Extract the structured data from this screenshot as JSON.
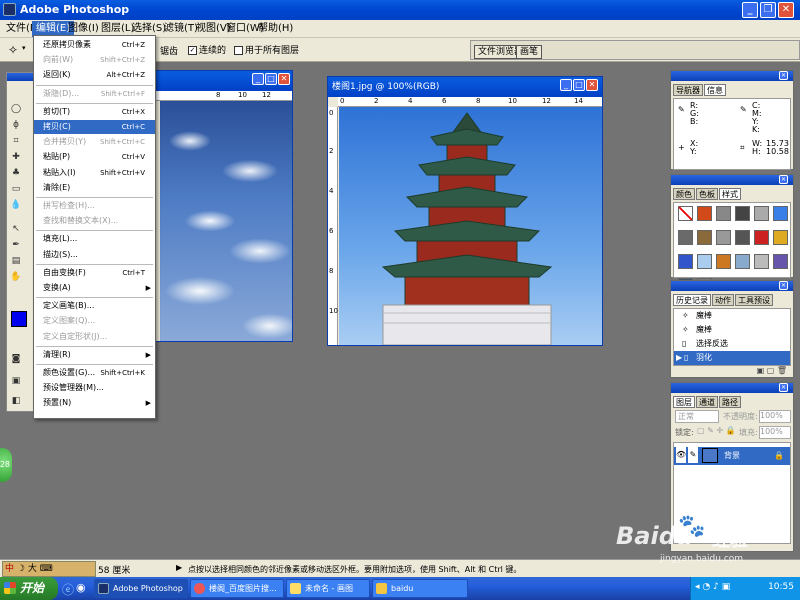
{
  "app": {
    "title": "Adobe Photoshop"
  },
  "menubar": [
    {
      "label": "文件(F)"
    },
    {
      "label": "编辑(E)"
    },
    {
      "label": "图像(I)"
    },
    {
      "label": "图层(L)"
    },
    {
      "label": "选择(S)"
    },
    {
      "label": "滤镜(T)"
    },
    {
      "label": "视图(V)"
    },
    {
      "label": "窗口(W)"
    },
    {
      "label": "帮助(H)"
    }
  ],
  "options": {
    "antialias_partial": "锯齿",
    "contiguous": "连续的",
    "all_layers": "用于所有图层"
  },
  "dock_tabs": [
    "文件浏览器",
    "画笔"
  ],
  "edit_menu": [
    {
      "label": "还原拷贝像素",
      "shortcut": "Ctrl+Z",
      "disabled": false
    },
    {
      "label": "向前(W)",
      "shortcut": "Shift+Ctrl+Z",
      "disabled": true
    },
    {
      "label": "返回(K)",
      "shortcut": "Alt+Ctrl+Z",
      "disabled": false
    },
    {
      "label": "渐隐(D)...",
      "shortcut": "Shift+Ctrl+F",
      "disabled": true
    },
    {
      "label": "剪切(T)",
      "shortcut": "Ctrl+X",
      "disabled": false
    },
    {
      "label": "拷贝(C)",
      "shortcut": "Ctrl+C",
      "disabled": false
    },
    {
      "label": "合并拷贝(Y)",
      "shortcut": "Shift+Ctrl+C",
      "disabled": true
    },
    {
      "label": "粘贴(P)",
      "shortcut": "Ctrl+V",
      "disabled": false
    },
    {
      "label": "粘贴入(I)",
      "shortcut": "Shift+Ctrl+V",
      "disabled": false
    },
    {
      "label": "清除(E)",
      "shortcut": "",
      "disabled": false
    },
    {
      "label": "拼写检查(H)...",
      "shortcut": "",
      "disabled": true
    },
    {
      "label": "查找和替换文本(X)...",
      "shortcut": "",
      "disabled": true
    },
    {
      "label": "填充(L)...",
      "shortcut": "",
      "disabled": false
    },
    {
      "label": "描边(S)...",
      "shortcut": "",
      "disabled": false
    },
    {
      "label": "自由变换(F)",
      "shortcut": "Ctrl+T",
      "disabled": false
    },
    {
      "label": "变换(A)",
      "shortcut": "",
      "disabled": false,
      "submenu": true
    },
    {
      "label": "定义画笔(B)...",
      "shortcut": "",
      "disabled": false
    },
    {
      "label": "定义图案(Q)...",
      "shortcut": "",
      "disabled": true
    },
    {
      "label": "定义自定形状(J)...",
      "shortcut": "",
      "disabled": true
    },
    {
      "label": "清理(R)",
      "shortcut": "",
      "disabled": false,
      "submenu": true
    },
    {
      "label": "颜色设置(G)...",
      "shortcut": "Shift+Ctrl+K",
      "disabled": false
    },
    {
      "label": "预设管理器(M)...",
      "shortcut": "",
      "disabled": false
    },
    {
      "label": "预置(N)",
      "shortcut": "",
      "disabled": false,
      "submenu": true
    }
  ],
  "edit_menu_highlighted": "拷贝(C)",
  "doc1": {
    "ruler": [
      "8",
      "10",
      "12"
    ]
  },
  "doc2": {
    "title": "楼阁1.jpg @ 100%(RGB)",
    "ruler": [
      "0",
      "2",
      "4",
      "6",
      "8",
      "10",
      "12",
      "14"
    ],
    "vruler": [
      "0",
      "2",
      "4",
      "6",
      "8",
      "10"
    ]
  },
  "navigator": {
    "tabs": [
      "导航器",
      "信息"
    ],
    "labels_left": [
      "R:",
      "G:",
      "B:"
    ],
    "labels_right": [
      "C:",
      "M:",
      "Y:",
      "K:"
    ],
    "x": "X:",
    "y": "Y:",
    "w": "W:",
    "h": "H:",
    "w_val": "15.73",
    "h_val": "10.58"
  },
  "swatches": {
    "tabs": [
      "颜色",
      "色板",
      "样式"
    ]
  },
  "history": {
    "tabs": [
      "历史记录",
      "动作",
      "工具预设"
    ],
    "items": [
      "魔棒",
      "魔棒",
      "选择反选",
      "羽化"
    ]
  },
  "layers": {
    "tabs": [
      "图层",
      "通道",
      "路径"
    ],
    "mode": "正常",
    "opacity_label": "不透明度:",
    "opacity": "100%",
    "lock_label": "锁定:",
    "fill_label": "填充:",
    "fill": "100%",
    "layer_name": "背景"
  },
  "status": {
    "ime": "中",
    "ime_extra": "大",
    "zoom": "58 厘米",
    "hint": "点按以选择相同颜色的邻近像素或移动选区外框。要用附加选项，使用 Shift、Alt 和 Ctrl 键。"
  },
  "taskbar": {
    "start": "开始",
    "tasks": [
      "Adobe Photoshop",
      "楼阁_百度图片搜...",
      "未命名 - 画图",
      "baidu"
    ],
    "clock": "10:55"
  },
  "badge": "28",
  "watermark": {
    "brand": "Baidu",
    "product": "经验",
    "url": "jingyan.baidu.com"
  },
  "colors": {
    "menu_highlight": "#316ac5",
    "xp_blue": "#0046d0",
    "foreground": "#0000ee"
  }
}
